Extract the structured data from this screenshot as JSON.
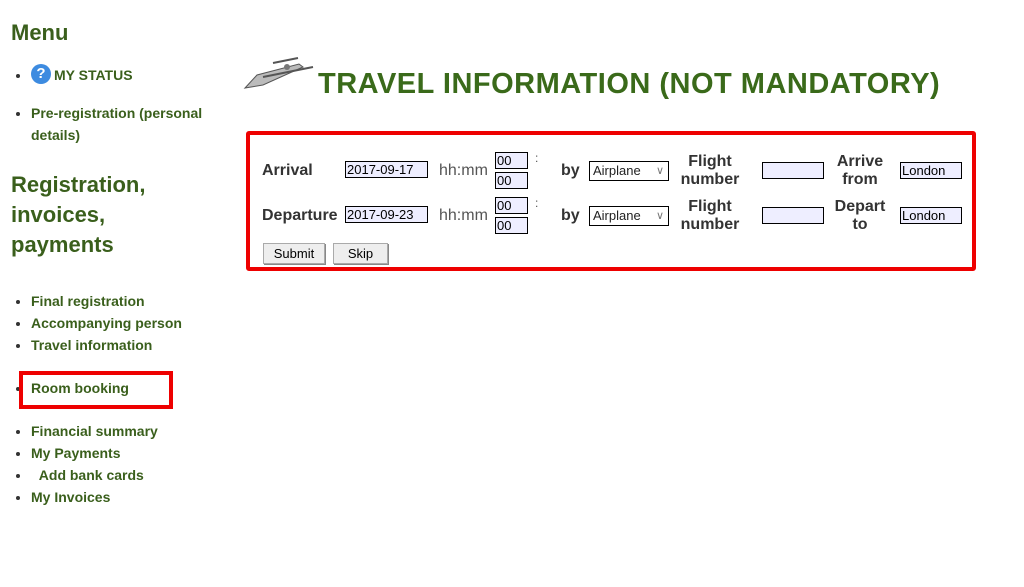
{
  "sidebar": {
    "menu_title": "Menu",
    "items_top": [
      {
        "label": "MY STATUS",
        "icon": "help-icon"
      },
      {
        "label": "Pre-registration (personal details)"
      }
    ],
    "section_title": "Registration, invoices, payments",
    "items": [
      {
        "label": "Final registration"
      },
      {
        "label": "Accompanying person"
      },
      {
        "label": "Travel information"
      },
      {
        "label": "Room booking"
      },
      {
        "label": "Financial summary"
      },
      {
        "label": "My Payments"
      },
      {
        "label": "Add bank cards"
      },
      {
        "label": "My Invoices"
      }
    ]
  },
  "page": {
    "title": "TRAVEL INFORMATION (NOT MANDATORY)",
    "icon": "airplane-icon"
  },
  "form": {
    "hhmm": "hh:mm",
    "colon": ":",
    "by": "by",
    "flight_label": "Flight number",
    "arrival": {
      "label": "Arrival",
      "date": "2017-09-17",
      "hour": "00",
      "minute": "00",
      "transport": "Airplane",
      "flight_number": "",
      "place_label": "Arrive from",
      "place": "London"
    },
    "departure": {
      "label": "Departure",
      "date": "2017-09-23",
      "hour": "00",
      "minute": "00",
      "transport": "Airplane",
      "flight_number": "",
      "place_label": "Depart to",
      "place": "London"
    },
    "submit": "Submit",
    "skip": "Skip"
  },
  "colors": {
    "green": "#3a5f1c",
    "highlight": "#ee0000"
  }
}
